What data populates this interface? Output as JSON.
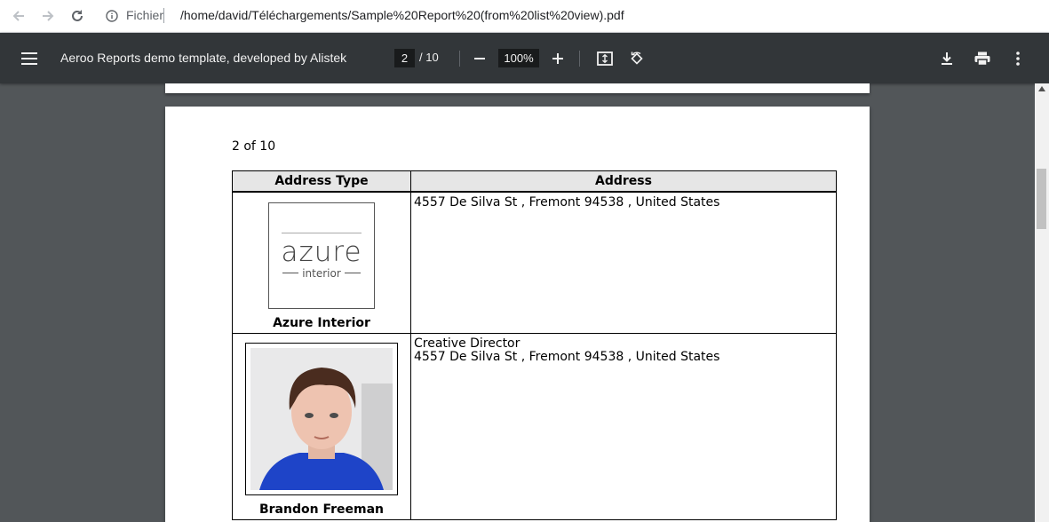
{
  "browser": {
    "scheme": "Fichier",
    "url": "/home/david/Téléchargements/Sample%20Report%20(from%20list%20view).pdf"
  },
  "toolbar": {
    "title": "Aeroo Reports demo template, developed by Alistek",
    "current_page": "2",
    "total_pages": "/ 10",
    "zoom": "100%"
  },
  "page": {
    "page_label": "2 of 10",
    "table": {
      "headers": [
        "Address Type",
        "Address"
      ],
      "rows": [
        {
          "name": "Azure Interior",
          "logo_word": "azure",
          "logo_sub": "interior",
          "address_line1": "4557 De Silva St , Fremont  94538 , United States",
          "address_line2": ""
        },
        {
          "name": "Brandon Freeman",
          "address_line1": "Creative Director",
          "address_line2": "4557 De Silva St , Fremont  94538 , United States"
        }
      ]
    }
  },
  "colors": {
    "toolbar_bg": "#323639",
    "viewer_bg": "#525659",
    "photo_bg": "#1e44c8"
  }
}
